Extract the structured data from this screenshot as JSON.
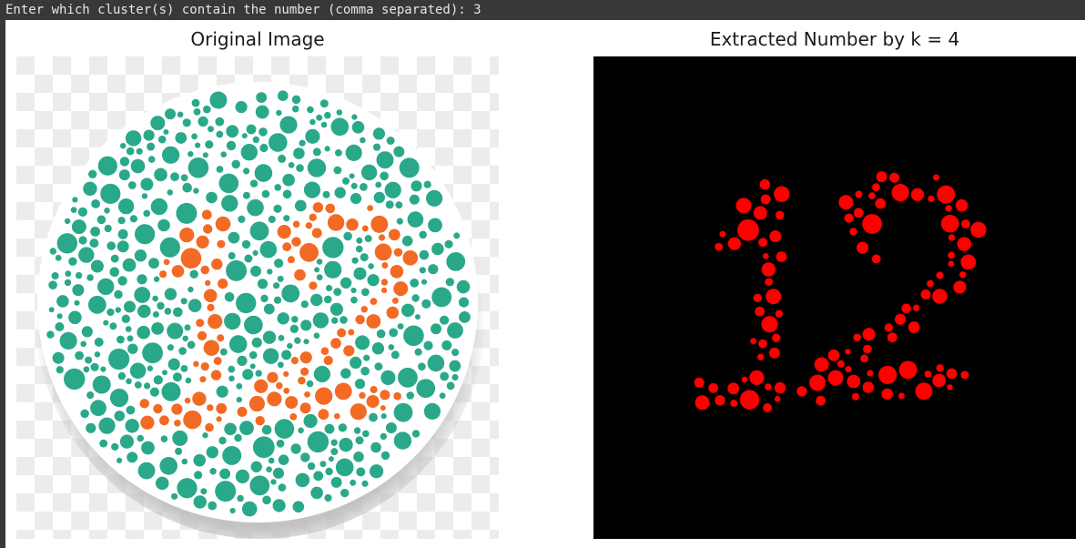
{
  "console": {
    "prompt": "Enter which cluster(s) contain the number (comma separated): ",
    "input_value": "3"
  },
  "figure": {
    "left_title": "Original Image",
    "right_title": "Extracted Number by k = 4"
  },
  "colors": {
    "teal": "#2aa88a",
    "orange": "#f26a24",
    "red": "#ff0000",
    "checker_light": "#ffffff",
    "checker_dark": "#ececec",
    "extracted_bg": "#000000"
  },
  "icons": {
    "left_panel": "ishihara-plate-image",
    "right_panel": "extracted-digits-image"
  }
}
